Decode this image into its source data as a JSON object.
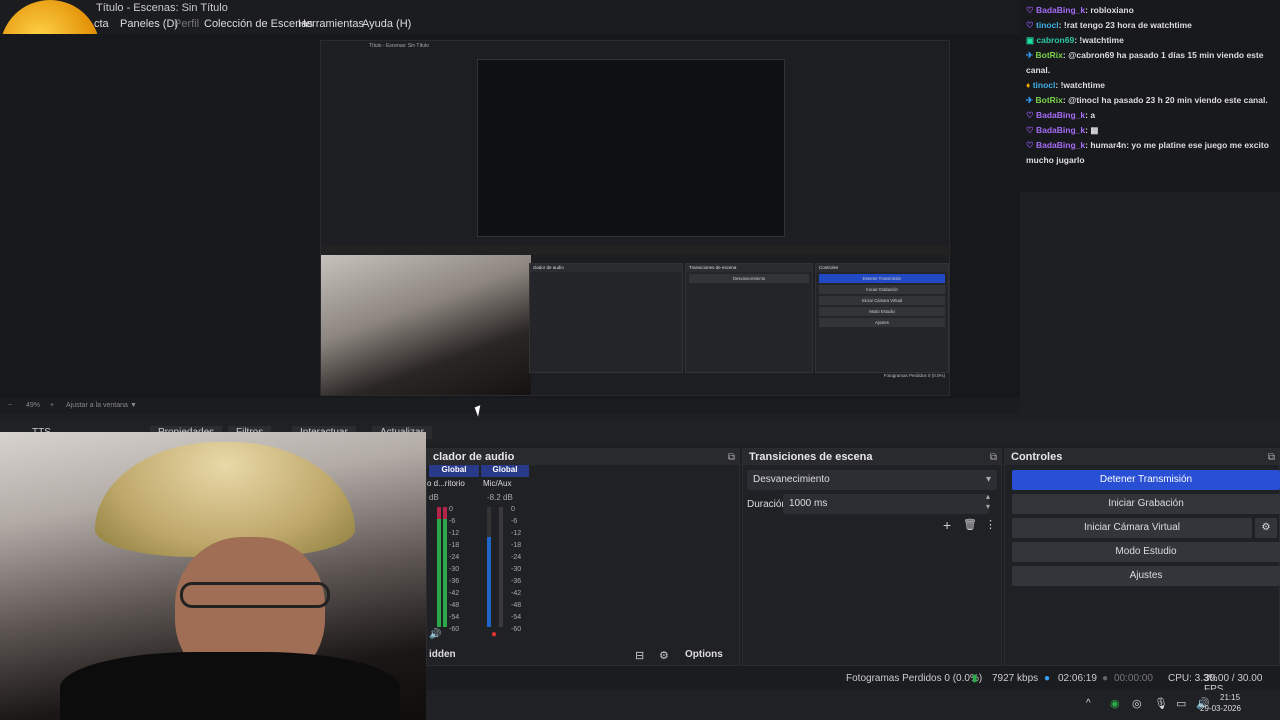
{
  "window": {
    "title": "Título - Escenas: Sin Título"
  },
  "menu": [
    "cta",
    "Paneles (D)",
    "Perfil",
    "Colección de Escenas",
    "Herramientas",
    "Ayuda (H)"
  ],
  "zoom": {
    "level": "49%",
    "mode": "Ajustar a la ventana"
  },
  "source_toolbar": {
    "source": "TTS",
    "properties": "Propiedades",
    "filters": "Filtros",
    "interact": "Interactuar",
    "refresh": "Actualizar"
  },
  "mixer": {
    "title": "clador de audio",
    "channels": [
      {
        "label": "Global",
        "device": "o d...ritorio",
        "db": "dB"
      },
      {
        "label": "Global",
        "device": "Mic/Aux",
        "db": "-8.2 dB"
      }
    ],
    "scale": [
      "0",
      "-6",
      "-12",
      "-18",
      "-24",
      "-30",
      "-36",
      "-42",
      "-48",
      "-54",
      "-60"
    ],
    "footer_label": "idden",
    "options": "Options"
  },
  "transitions": {
    "title": "Transiciones de escena",
    "selected": "Desvanecimiento",
    "duration_label": "Duración",
    "duration": "1000 ms"
  },
  "controls": {
    "title": "Controles",
    "buttons": [
      "Detener Transmisión",
      "Iniciar Grabación",
      "Iniciar Cámara Virtual",
      "Modo Estudio",
      "Ajustes"
    ]
  },
  "status": {
    "frames": "Fotogramas Perdidos 0 (0.0%)",
    "bitrate": "7927 kbps",
    "stream_time": "02:06:19",
    "rec_time": "00:00:00",
    "cpu": "CPU: 3.3%",
    "fps": "30.00 / 30.00 FPS"
  },
  "taskbar": {
    "time": "21:15",
    "date": "29-03-2026"
  },
  "chat": [
    {
      "icon": "heart",
      "user": "BadaBing_k",
      "user_color": "#a56cf7",
      "text": "robloxiano"
    },
    {
      "icon": "heart",
      "user": "tinocl",
      "user_color": "#3fb0e6",
      "text": "!rat tengo 23 hora de watchtime"
    },
    {
      "icon": "box",
      "user": "cabron69",
      "user_color": "#2bc8a8",
      "text": "!watchtime"
    },
    {
      "icon": "rocket",
      "user": "BotRix",
      "user_color": "#7bd24b",
      "text": "@cabron69 ha pasado 1 días 15 min viendo este canal."
    },
    {
      "icon": "star",
      "user": "tinocl",
      "user_color": "#3fb0e6",
      "text": "!watchtime"
    },
    {
      "icon": "rocket",
      "user": "BotRix",
      "user_color": "#7bd24b",
      "text": "@tinocl ha pasado 23 h 20 min viendo este canal."
    },
    {
      "icon": "heart",
      "user": "BadaBing_k",
      "user_color": "#a56cf7",
      "text": "a"
    },
    {
      "icon": "heart",
      "user": "BadaBing_k",
      "user_color": "#a56cf7",
      "text": "▦"
    },
    {
      "icon": "heart",
      "user": "BadaBing_k",
      "user_color": "#a56cf7",
      "text": "humar4n: yo me platine ese juego me excito mucho jugarlo"
    }
  ]
}
